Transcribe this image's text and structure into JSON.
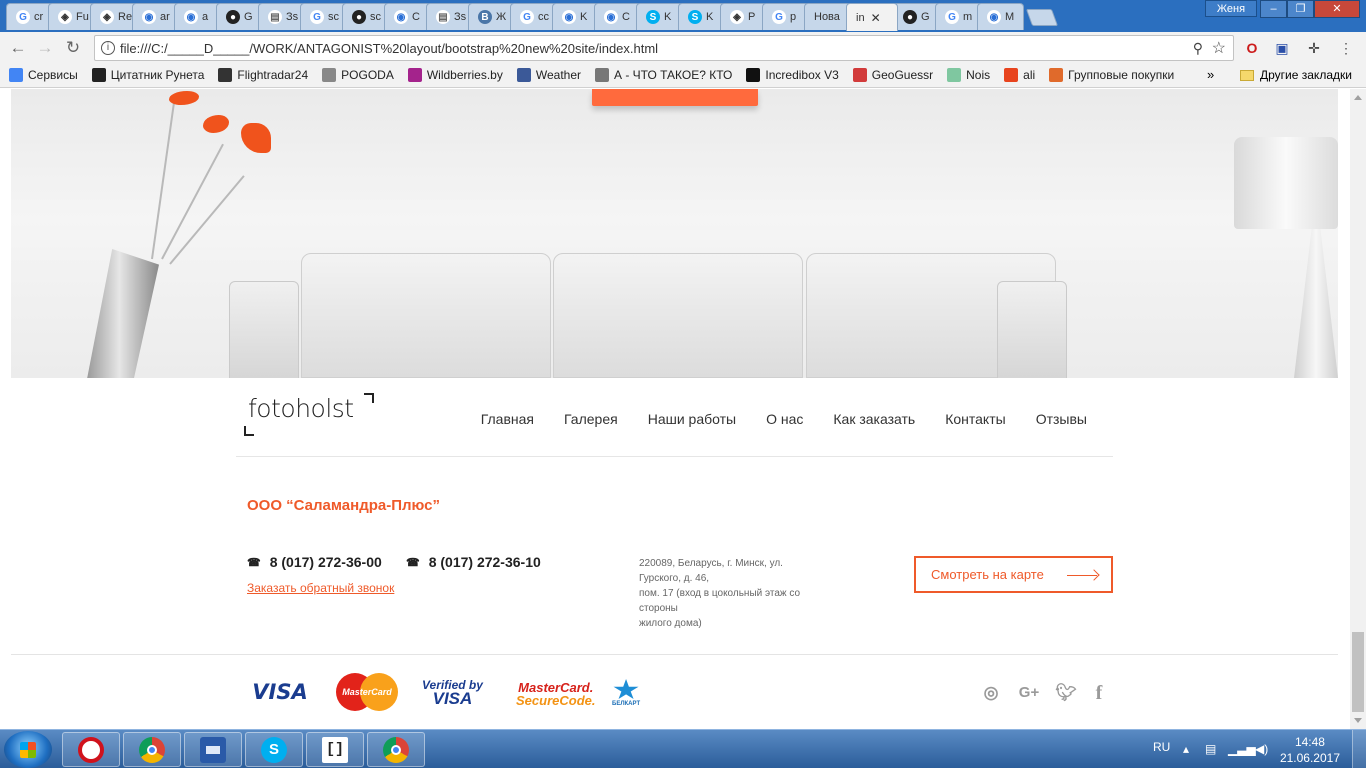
{
  "browser": {
    "tabs": [
      {
        "label": "cr",
        "icon": "google-icon"
      },
      {
        "label": "Fu",
        "icon": "codepen-icon"
      },
      {
        "label": "Re",
        "icon": "codepen-icon"
      },
      {
        "label": "ar",
        "icon": "site-icon"
      },
      {
        "label": "a",
        "icon": "site-icon"
      },
      {
        "label": "G",
        "icon": "github-icon"
      },
      {
        "label": "Зs",
        "icon": "document-icon"
      },
      {
        "label": "sc",
        "icon": "google-icon"
      },
      {
        "label": "sc",
        "icon": "github-icon"
      },
      {
        "label": "C",
        "icon": "site-icon"
      },
      {
        "label": "Зs",
        "icon": "document-icon"
      },
      {
        "label": "Ж",
        "icon": "vk-icon"
      },
      {
        "label": "cc",
        "icon": "google-icon"
      },
      {
        "label": "K",
        "icon": "site-icon"
      },
      {
        "label": "C",
        "icon": "site-icon"
      },
      {
        "label": "K",
        "icon": "skype-icon"
      },
      {
        "label": "K",
        "icon": "skype-icon"
      },
      {
        "label": "P",
        "icon": "codepen-icon"
      },
      {
        "label": "p",
        "icon": "google-icon"
      },
      {
        "label": "Нова",
        "icon": ""
      },
      {
        "label": "in",
        "icon": "",
        "active": true
      },
      {
        "label": "G",
        "icon": "github-icon"
      },
      {
        "label": "m",
        "icon": "google-icon"
      },
      {
        "label": "M",
        "icon": "site-icon"
      }
    ],
    "user_badge": "Женя",
    "url": "file:///C:/_____D_____/WORK/ANTAGONIST%20layout/bootstrap%20new%20site/index.html",
    "bookmarks": [
      {
        "label": "Сервисы",
        "icon": "apps-grid-icon",
        "color": "#4285f4"
      },
      {
        "label": "Цитатник Рунета",
        "icon": "b-icon",
        "color": "#222222"
      },
      {
        "label": "Flightradar24",
        "icon": "radar-icon",
        "color": "#333333"
      },
      {
        "label": "POGODA",
        "icon": "weather-icon",
        "color": "#888888"
      },
      {
        "label": "Wildberries.by",
        "icon": "wildberries-icon",
        "color": "#a4238c"
      },
      {
        "label": "Weather",
        "icon": "weather-icon",
        "color": "#3b5998"
      },
      {
        "label": "А - ЧТО ТАКОЕ? КТО",
        "icon": "page-icon",
        "color": "#777777"
      },
      {
        "label": "Incredibox V3",
        "icon": "music-icon",
        "color": "#111111"
      },
      {
        "label": "GeoGuessr",
        "icon": "pin-icon",
        "color": "#d23b3b"
      },
      {
        "label": "Nois",
        "icon": "noisli-icon",
        "color": "#7fc7a0"
      },
      {
        "label": "ali",
        "icon": "ali-icon",
        "color": "#e8441e"
      },
      {
        "label": "Групповые покупки",
        "icon": "group-buy-icon",
        "color": "#e06a2b"
      }
    ],
    "bookmarks_more": "»",
    "other_bookmarks": "Другие закладки"
  },
  "site": {
    "logo": "fotoholst",
    "nav": [
      "Главная",
      "Галерея",
      "Наши работы",
      "О нас",
      "Как заказать",
      "Контакты",
      "Отзывы"
    ],
    "company": "ООО “Саламандра-Плюс”",
    "phone1": "8 (017) 272-36-00",
    "phone2": "8 (017) 272-36-10",
    "callback": "Заказать обратный звонок",
    "address_lines": [
      "220089, Беларусь, г. Минск, ул.",
      "Гурского, д. 46,",
      "пом. 17 (вход в цокольный этаж со",
      "стороны",
      "жилого дома)"
    ],
    "map_button": "Смотреть на карте",
    "payments": {
      "visa": "VISA",
      "mastercard": "MasterCard",
      "vbv_top": "Verified by",
      "vbv_bottom": "VISA",
      "mcsc_top": "MasterCard.",
      "mcsc_bottom": "SecureCode.",
      "belkart": "БЕЛКАРТ"
    },
    "social": [
      "instagram-icon",
      "google-plus-icon",
      "twitter-icon",
      "facebook-icon"
    ],
    "accent": "#ef5a2a"
  },
  "taskbar": {
    "apps": [
      "opera-icon",
      "chrome-icon",
      "save-disk-icon",
      "skype-icon",
      "brackets-icon",
      "chrome-icon"
    ],
    "lang": "RU",
    "time": "14:48",
    "date": "21.06.2017"
  }
}
